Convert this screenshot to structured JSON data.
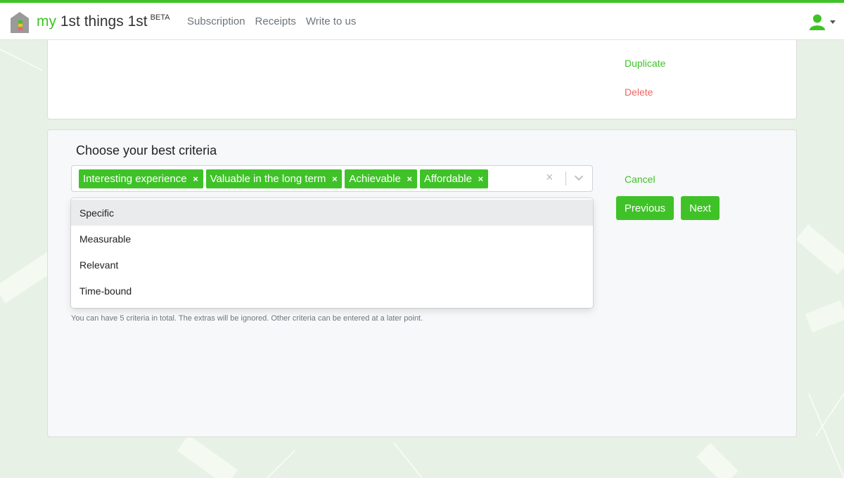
{
  "brand": {
    "prefix": "my",
    "name": "1st things 1st",
    "badge": "BETA"
  },
  "nav": {
    "links": [
      "Subscription",
      "Receipts",
      "Write to us"
    ]
  },
  "colors": {
    "accent": "#3fc228",
    "danger": "#ef6461"
  },
  "top_card": {
    "duplicate_label": "Duplicate",
    "delete_label": "Delete"
  },
  "criteria": {
    "title": "Choose your best criteria",
    "selected": [
      "Interesting experience",
      "Valuable in the long term",
      "Achievable",
      "Affordable"
    ],
    "remove_glyph": "×",
    "clear_glyph": "×",
    "options": [
      "Specific",
      "Measurable",
      "Relevant",
      "Time-bound"
    ],
    "help_text": "You can have 5 criteria in total. The extras will be ignored. Other criteria can be entered at a later point."
  },
  "actions": {
    "cancel_label": "Cancel",
    "previous_label": "Previous",
    "next_label": "Next"
  },
  "icons": {
    "logo": "house-icon",
    "user": "user-icon",
    "dropdown": "chevron-down-icon"
  }
}
